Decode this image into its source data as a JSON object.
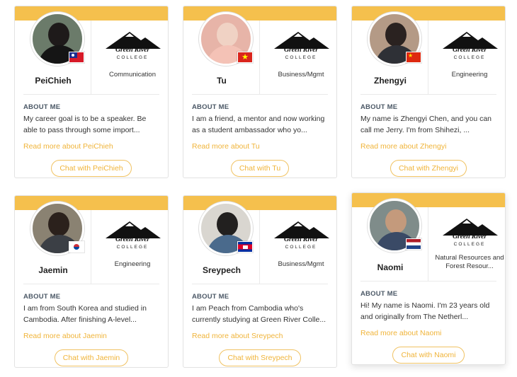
{
  "colors": {
    "accent": "#f5c04d",
    "link": "#f0b43a",
    "heading": "#4b5866"
  },
  "college": {
    "logo_text": "Green River",
    "logo_sub": "COLLEGE"
  },
  "about_label": "ABOUT ME",
  "cards": [
    {
      "name": "PeiChieh",
      "major": "Communication",
      "flag": "taiwan-flag",
      "about": "My career goal is to be a speaker. Be able to pass through some import...",
      "read_more": "Read more about PeiChieh",
      "chat": "Chat with PeiChieh"
    },
    {
      "name": "Tu",
      "major": "Business/Mgmt",
      "flag": "vietnam-flag",
      "about": "I am a friend, a mentor and now working as a student ambassador who yo...",
      "read_more": "Read more about Tu",
      "chat": "Chat with Tu"
    },
    {
      "name": "Zhengyi",
      "major": "Engineering",
      "flag": "china-flag",
      "about": "My name is Zhengyi Chen, and you can call me Jerry. I'm from Shihezi, ...",
      "read_more": "Read more about Zhengyi",
      "chat": "Chat with Zhengyi"
    },
    {
      "name": "Jaemin",
      "major": "Engineering",
      "flag": "south-korea-flag",
      "about": "I am from South Korea and studied in Cambodia. After finishing A-level...",
      "read_more": "Read more about Jaemin",
      "chat": "Chat with Jaemin"
    },
    {
      "name": "Sreypech",
      "major": "Business/Mgmt",
      "flag": "cambodia-flag",
      "about": "I am Peach from Cambodia who's currently studying at Green River Colle...",
      "read_more": "Read more about Sreypech",
      "chat": "Chat with Sreypech"
    },
    {
      "name": "Naomi",
      "major": "Natural Resources and Forest Resour...",
      "flag": "netherlands-flag",
      "about": "Hi! My name is Naomi. I'm 23 years old and originally from The Netherl...",
      "read_more": "Read more about Naomi",
      "chat": "Chat with Naomi"
    }
  ]
}
